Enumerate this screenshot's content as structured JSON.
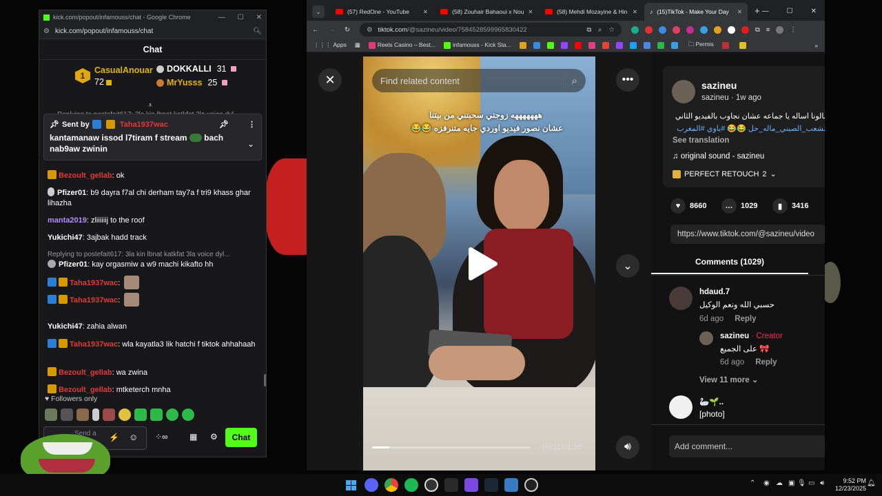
{
  "kick": {
    "tab_title": "kick.com/popout/infamouss/chat - Google Chrome",
    "url": "kick.com/popout/infamouss/chat",
    "chat_title": "Chat",
    "leaderboard": [
      {
        "rank": "1",
        "name": "CasualAnouar",
        "count": "72",
        "color": "#e0b400"
      },
      {
        "name": "DOKKALLI",
        "count": "31"
      },
      {
        "name": "MrYusss",
        "count": "25"
      }
    ],
    "pinned": {
      "behind_text": "Replying to postefait617: 3la kin lbnat katkfat 3la voice dyl...",
      "sent_by_label": "Sent by",
      "user": "Taha1937wac",
      "text": "kantamanaw issod l7tiram f stream",
      "text2": "bach nab9aw zwinin"
    },
    "messages": [
      {
        "user": "Bezoult_gellab",
        "text": ": ok",
        "color": "#e03a3a"
      },
      {
        "user": "Pfizer01",
        "text": ": b9 dayra f7al chi derham tay7a f tri9 khass ghar lihazha",
        "color": "#ffffff"
      },
      {
        "user": "manta2019",
        "text": ": zliiiiiij to the roof",
        "color": "#b48cff"
      },
      {
        "user": "Yukichi47",
        "text": ": 3ajbak hadd track",
        "color": "#ffffff"
      },
      {
        "reply": "Replying to postefait617: 3la kin lbnat katkfat 3la voice dyl...",
        "user": "Pfizer01",
        "text": ": kay orgasmiw a w9 machi kikafto hh",
        "color": "#ffffff"
      },
      {
        "user": "Taha1937wac",
        "text": ":",
        "color": "#e03a3a"
      },
      {
        "user": "Taha1937wac",
        "text": ":",
        "color": "#e03a3a"
      },
      {
        "user": "Yukichi47",
        "text": ": zahia alwan",
        "color": "#ffffff"
      },
      {
        "user": "Taha1937wac",
        "text": ": wla kayatla3 lik hatchi f tiktok ahhahaah",
        "color": "#e03a3a"
      },
      {
        "user": "Bezoult_gellab",
        "text": ": wa zwina",
        "color": "#e03a3a"
      },
      {
        "user": "Bezoult_gellab",
        "text": ": mtketerch mnha",
        "color": "#e03a3a"
      }
    ],
    "followers_only": "Followers only",
    "send_placeholder": "Send a",
    "chat_button": "Chat"
  },
  "chrome": {
    "tabs": [
      {
        "label": "(57) RedOne - YouTube"
      },
      {
        "label": "(58) Zouhair Bahaoui x Nou"
      },
      {
        "label": "(58) Mehdi Mozayine & Hin"
      },
      {
        "label": "(15)TikTok - Make Your Day"
      }
    ],
    "url_host": "tiktok.com",
    "url_path": "/@sazineu/video/7584528599965830422",
    "bookmarks": [
      "Apps",
      "Reels Casino – Best...",
      "infamouss - Kick Sta..."
    ],
    "bookmark_folder": "Permis"
  },
  "tiktok": {
    "search_placeholder": "Find related content",
    "caption_line1": "هههههههه زوجتي سحبتني من بيتنا",
    "caption_line2": "عشان نصور فيديو اوردي جايه متنرفزه 😂😂",
    "time": "00:11/01:38",
    "progress": 0.11,
    "author": "sazineu",
    "author_sub": "sazineu · 1w ago",
    "description": "اسالونا اساله يا جماعه عشان نجاوب بالفيديو الثاني",
    "hashtags": "#الشعب_الصيني_ماله_حل 😂😂 #ياوي #المغرب",
    "see_translation": "See translation",
    "sound": "original sound - sazineu",
    "effect": "PERFECT RETOUCH",
    "effect_count": "2",
    "likes": "8660",
    "comments": "1029",
    "saves": "3416",
    "link": "https://www.tiktok.com/@sazineu/video",
    "comments_tab": "Comments (1029)",
    "comment1_user": "hdaud.7",
    "comment1_text": "حسبي الله ونعم الوكيل",
    "comment1_time": "6d ago",
    "reply_label": "Reply",
    "reply_user": "sazineu",
    "creator_label": "Creator",
    "reply_text": "على الجميع 🎀",
    "reply_time": "6d ago",
    "view_more": "View 11 more",
    "comment2_user": "🦢🌱..",
    "comment2_text": "[photo]",
    "add_comment": "Add comment..."
  },
  "taskbar": {
    "time": "9:52 PM",
    "date": "12/23/2025"
  }
}
